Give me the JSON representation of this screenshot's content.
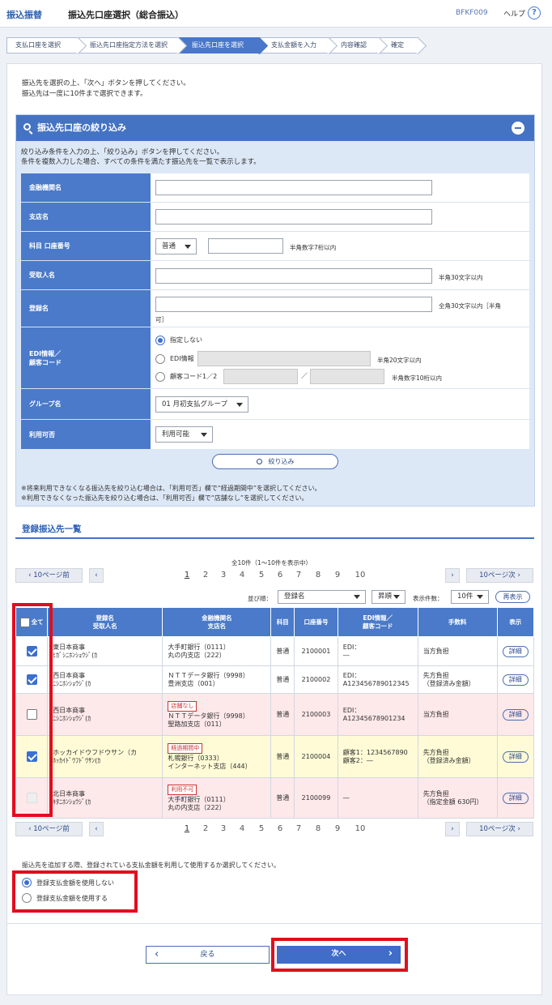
{
  "header": {
    "service": "振込振替",
    "title": "振込先口座選択（総合振込）",
    "code": "BFKF009",
    "help": "ヘルプ",
    "help_icon": "?"
  },
  "steps": [
    "支払口座を選択",
    "振込先口座指定方法を選択",
    "振込先口座を選択",
    "支払金額を入力",
    "内容確認",
    "確定"
  ],
  "intro": [
    "振込先を選択の上、「次へ」ボタンを押してください。",
    "振込先は一度に10件まで選択できます。"
  ],
  "filter": {
    "title": "振込先口座の絞り込み",
    "desc": [
      "絞り込み条件を入力の上、「絞り込み」ボタンを押してください。",
      "条件を複数入力した場合、すべての条件を満たす振込先を一覧で表示します。"
    ],
    "labels": {
      "bank": "金融機関名",
      "branch": "支店名",
      "account": "科目 口座番号",
      "payee": "受取人名",
      "regname": "登録名",
      "edi": "EDI情報／",
      "edi2": "顧客コード",
      "group": "グループ名",
      "avail": "利用可否"
    },
    "account_type": "普通",
    "account_note": "半角数字7桁以内",
    "payee_note": "半角30文字以内",
    "regname_note": "全角30文字以内［半角",
    "regname_note2": "可］",
    "edi_none": "指定しない",
    "edi_info": "EDI情報",
    "edi_info_note": "半角20文字以内",
    "edi_cust": "顧客コード1／2",
    "edi_slash": "／",
    "edi_cust_note": "半角数字10桁以内",
    "group_value": "01 月初支払グループ",
    "avail_value": "利用可能",
    "button": "絞り込み",
    "warn": [
      "※将来利用できなくなる振込先を絞り込む場合は、「利用可否」欄で“経過期間中”を選択してください。",
      "※利用できなくなった振込先を絞り込む場合は、「利用可否」欄で“店舗なし”を選択してください。"
    ]
  },
  "list": {
    "title": "登録振込先一覧",
    "count": "全10件（1～10件を表示中）",
    "prev10": "10ページ前",
    "next10": "10ページ次",
    "pages": [
      "1",
      "2",
      "3",
      "4",
      "5",
      "6",
      "7",
      "8",
      "9",
      "10"
    ],
    "sort_label": "並び順：",
    "sort_value": "登録名",
    "order_value": "昇順",
    "per_page_label": "表示件数：",
    "per_page_value": "10件",
    "redisplay": "再表示",
    "cols": {
      "all": "全て",
      "name1": "登録名",
      "name2": "受取人名",
      "bank1": "金融機関名",
      "bank2": "支店名",
      "type": "科目",
      "acct": "口座番号",
      "edi1": "EDI情報／",
      "edi2": "顧客コード",
      "fee": "手数料",
      "show": "表示"
    },
    "rows": [
      {
        "checked": true,
        "name": "東日本商事",
        "kana": "ﾋｶﾞｼﾆﾎﾝｼｮｳｼﾞ(ｶ",
        "tag": "",
        "bank": "大手町銀行（0111）",
        "branch": "丸の内支店（222）",
        "type": "普通",
        "acct": "2100001",
        "edi1": "EDI：",
        "edi2": "―",
        "fee1": "当方負担",
        "fee2": "",
        "detail": "詳細",
        "bg": "#ffffff"
      },
      {
        "checked": true,
        "name": "西日本商事",
        "kana": "ﾆｼﾆﾎﾝｼｮｳｼﾞ(ｶ",
        "tag": "",
        "bank": "ＮＴＴデータ銀行（9998）",
        "branch": "豊洲支店（001）",
        "type": "普通",
        "acct": "2100002",
        "edi1": "EDI：",
        "edi2": "A123456789012345",
        "fee1": "先方負担",
        "fee2": "（登録済み金額）",
        "detail": "詳細",
        "bg": "#ffffff"
      },
      {
        "checked": false,
        "name": "西日本商事",
        "kana": "ﾆｼﾆﾎﾝｼｮｳｼﾞ(ｶ",
        "tag": "店舗なし",
        "bank": "ＮＴＴデータ銀行（9998）",
        "branch": "聖路加支店（011）",
        "type": "普通",
        "acct": "2100003",
        "edi1": "EDI：",
        "edi2": "A12345678901234",
        "fee1": "当方負担",
        "fee2": "",
        "detail": "詳細",
        "bg": "#fde8ea"
      },
      {
        "checked": true,
        "name": "ホッカイドウフドウサン（カ",
        "kana": "ﾎｯｶｲﾄﾞｳﾌﾄﾞｳｻﾝ(ｶ",
        "tag": "経過期間中",
        "bank": "札幌銀行（0333）",
        "branch": "インターネット支店（444）",
        "type": "普通",
        "acct": "2100004",
        "edi1": "顧客1：1234567890",
        "edi2": "顧客2：―",
        "fee1": "先方負担",
        "fee2": "（登録済み金額）",
        "detail": "詳細",
        "bg": "#fefbd6"
      },
      {
        "checked": false,
        "name": "北日本商事",
        "kana": "ｷﾀﾆﾎﾝｼｮｳｼﾞ(ｶ",
        "tag": "利用不可",
        "bank": "大手町銀行（0111）",
        "branch": "丸の内支店（222）",
        "type": "普通",
        "acct": "2100099",
        "edi1": "―",
        "edi2": "",
        "fee1": "先方負担",
        "fee2": "（指定金額 630円）",
        "detail": "詳細",
        "bg": "#fde8ea",
        "disabled": true
      }
    ]
  },
  "amount": {
    "question": "振込先を追加する際、登録されている支払金額を利用して使用するか選択してください。",
    "opt1": "登録支払金額を使用しない",
    "opt2": "登録支払金額を使用する"
  },
  "footer": {
    "back": "戻る",
    "next": "次へ"
  }
}
